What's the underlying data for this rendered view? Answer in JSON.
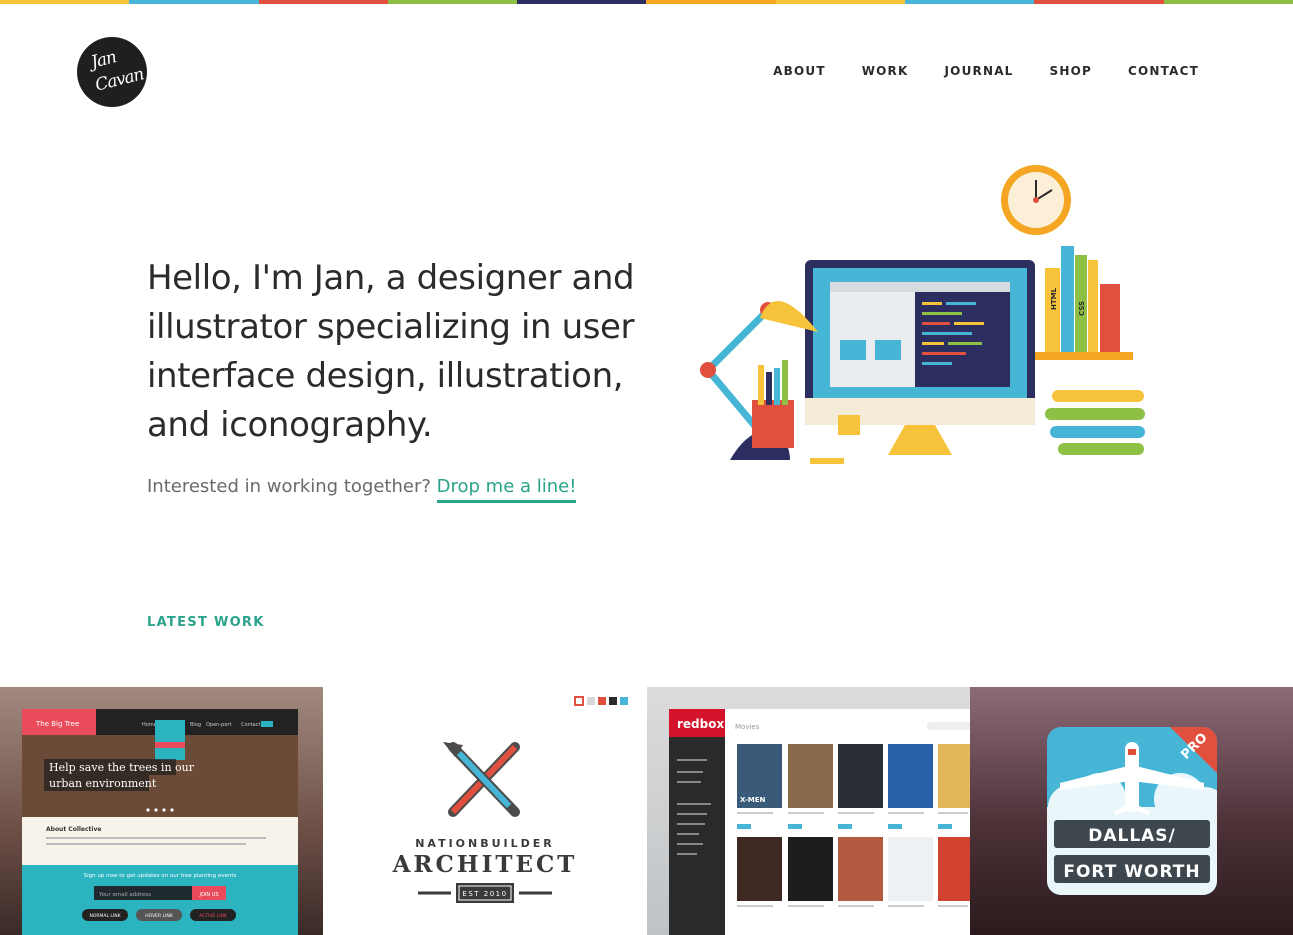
{
  "colors": {
    "accent": "#2aa38a",
    "stripe": [
      "#f7c33a",
      "#47b6d6",
      "#e1503e",
      "#8ec045",
      "#2b2e5e",
      "#f5a623",
      "#47b6d6",
      "#e1503e",
      "#8ec045"
    ]
  },
  "logo": {
    "line1": "Jan",
    "line2": "Cavan"
  },
  "nav": {
    "items": [
      {
        "label": "ABOUT"
      },
      {
        "label": "WORK"
      },
      {
        "label": "JOURNAL"
      },
      {
        "label": "SHOP"
      },
      {
        "label": "CONTACT"
      }
    ]
  },
  "hero": {
    "headline": "Hello, I'm Jan, a designer and illustrator specializing in user interface design, illustration, and iconography.",
    "cta_text": "Interested in working together?",
    "cta_link": "Drop me a line!",
    "illustration": {
      "labels": [
        "HTML",
        "CSS"
      ]
    }
  },
  "latest": {
    "title": "LATEST WORK",
    "items": [
      {
        "brand": "The Big Tree",
        "nav": [
          "Home",
          "Blog",
          "Open-port",
          "Contact"
        ],
        "headline_1": "Help save the trees in our",
        "headline_2": "urban environment",
        "section": "About Collective",
        "signup": "Sign up now to get updates on our tree planting events",
        "input_placeholder": "Your email address",
        "join": "JOIN US",
        "buttons": [
          "NORMAL LINK",
          "HOVER LINK",
          "ACTIVE LINK"
        ]
      },
      {
        "name": "NATIONBUILDER",
        "title": "ARCHITECT",
        "est": "EST 2010"
      },
      {
        "brand": "redbox.",
        "section": "Movies",
        "poster_title": "X-MEN"
      },
      {
        "line1": "DALLAS/",
        "line2": "FORT WORTH",
        "badge": "PRO"
      }
    ]
  }
}
